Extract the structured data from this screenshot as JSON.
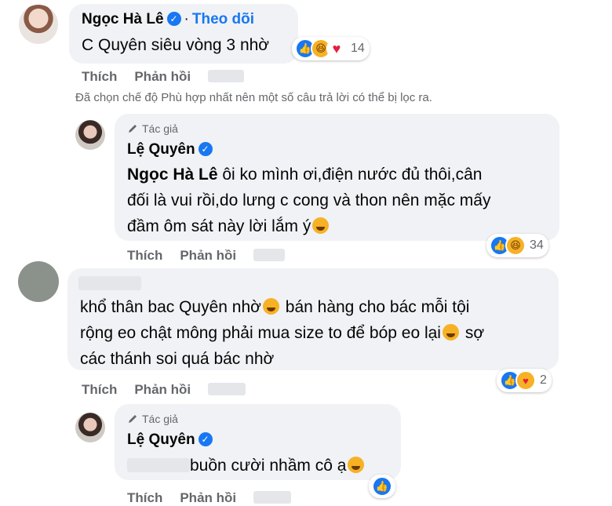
{
  "comment1": {
    "author": "Ngọc Hà Lê",
    "follow_separator": "·",
    "follow_label": "Theo dõi",
    "text": "C Quyên siêu vòng 3 nhờ",
    "reaction_count": "14",
    "like_label": "Thích",
    "reply_label": "Phản hồi"
  },
  "filter_notice": "Đã chọn chế độ Phù hợp nhất nên một số câu trả lời có thể bị lọc ra.",
  "reply1": {
    "tag": "Tác giả",
    "author": "Lệ Quyên",
    "mention": "Ngọc Hà Lê",
    "line1": " ôi ko mình ơi,điện nước đủ thôi,cân",
    "line2": "đối là vui rồi,do lưng c cong và thon nên mặc mấy",
    "line3": "đầm ôm sát này lời lắm ý",
    "reaction_count": "34",
    "like_label": "Thích",
    "reply_label": "Phản hồi"
  },
  "comment2": {
    "line1": "khổ thân bac Quyên nhờ",
    "line1b": " bán hàng cho bác mỗi tội",
    "line2": "rộng eo chật mông phải mua size to để bóp eo lại",
    "line2b": " sợ",
    "line3": "các thánh soi quá bác nhờ",
    "reaction_count": "2",
    "like_label": "Thích",
    "reply_label": "Phản hồi"
  },
  "reply2": {
    "tag": "Tác giả",
    "author": "Lệ Quyên",
    "text": "buồn cười nhầm cô ạ",
    "like_label": "Thích",
    "reply_label": "Phản hồi"
  },
  "colors": {
    "bubble": "#f0f2f5",
    "link": "#1877f2",
    "meta": "#65676b"
  }
}
